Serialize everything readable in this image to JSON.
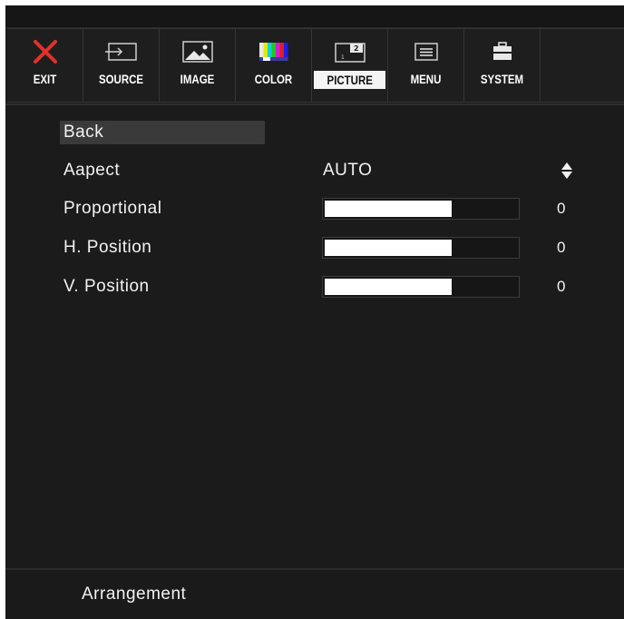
{
  "toolbar": {
    "tabs": [
      {
        "id": "exit",
        "label": "EXIT",
        "icon": "close-x-icon"
      },
      {
        "id": "source",
        "label": "SOURCE",
        "icon": "input-source-icon"
      },
      {
        "id": "image",
        "label": "IMAGE",
        "icon": "image-landscape-icon"
      },
      {
        "id": "color",
        "label": "COLOR",
        "icon": "color-bars-icon"
      },
      {
        "id": "picture",
        "label": "PICTURE",
        "icon": "picture-in-picture-icon",
        "active": true
      },
      {
        "id": "menu",
        "label": "MENU",
        "icon": "menu-list-icon"
      },
      {
        "id": "system",
        "label": "SYSTEM",
        "icon": "toolbox-icon"
      }
    ]
  },
  "menu": {
    "back": "Back",
    "aspect": {
      "label": "Aapect",
      "value": "AUTO",
      "icon": "up-down-arrows-icon"
    },
    "proportional": {
      "label": "Proportional",
      "value": "0",
      "fill_percent": 66
    },
    "h_position": {
      "label": "H. Position",
      "value": "0",
      "fill_percent": 66
    },
    "v_position": {
      "label": "V. Position",
      "value": "0",
      "fill_percent": 66
    }
  },
  "footer": {
    "hint": "Arrangement"
  },
  "colors": {
    "background": "#1b1b1b",
    "text": "#f2f2f2",
    "exit_icon": "#e0322d",
    "active_tab": "#f4f4f4"
  }
}
